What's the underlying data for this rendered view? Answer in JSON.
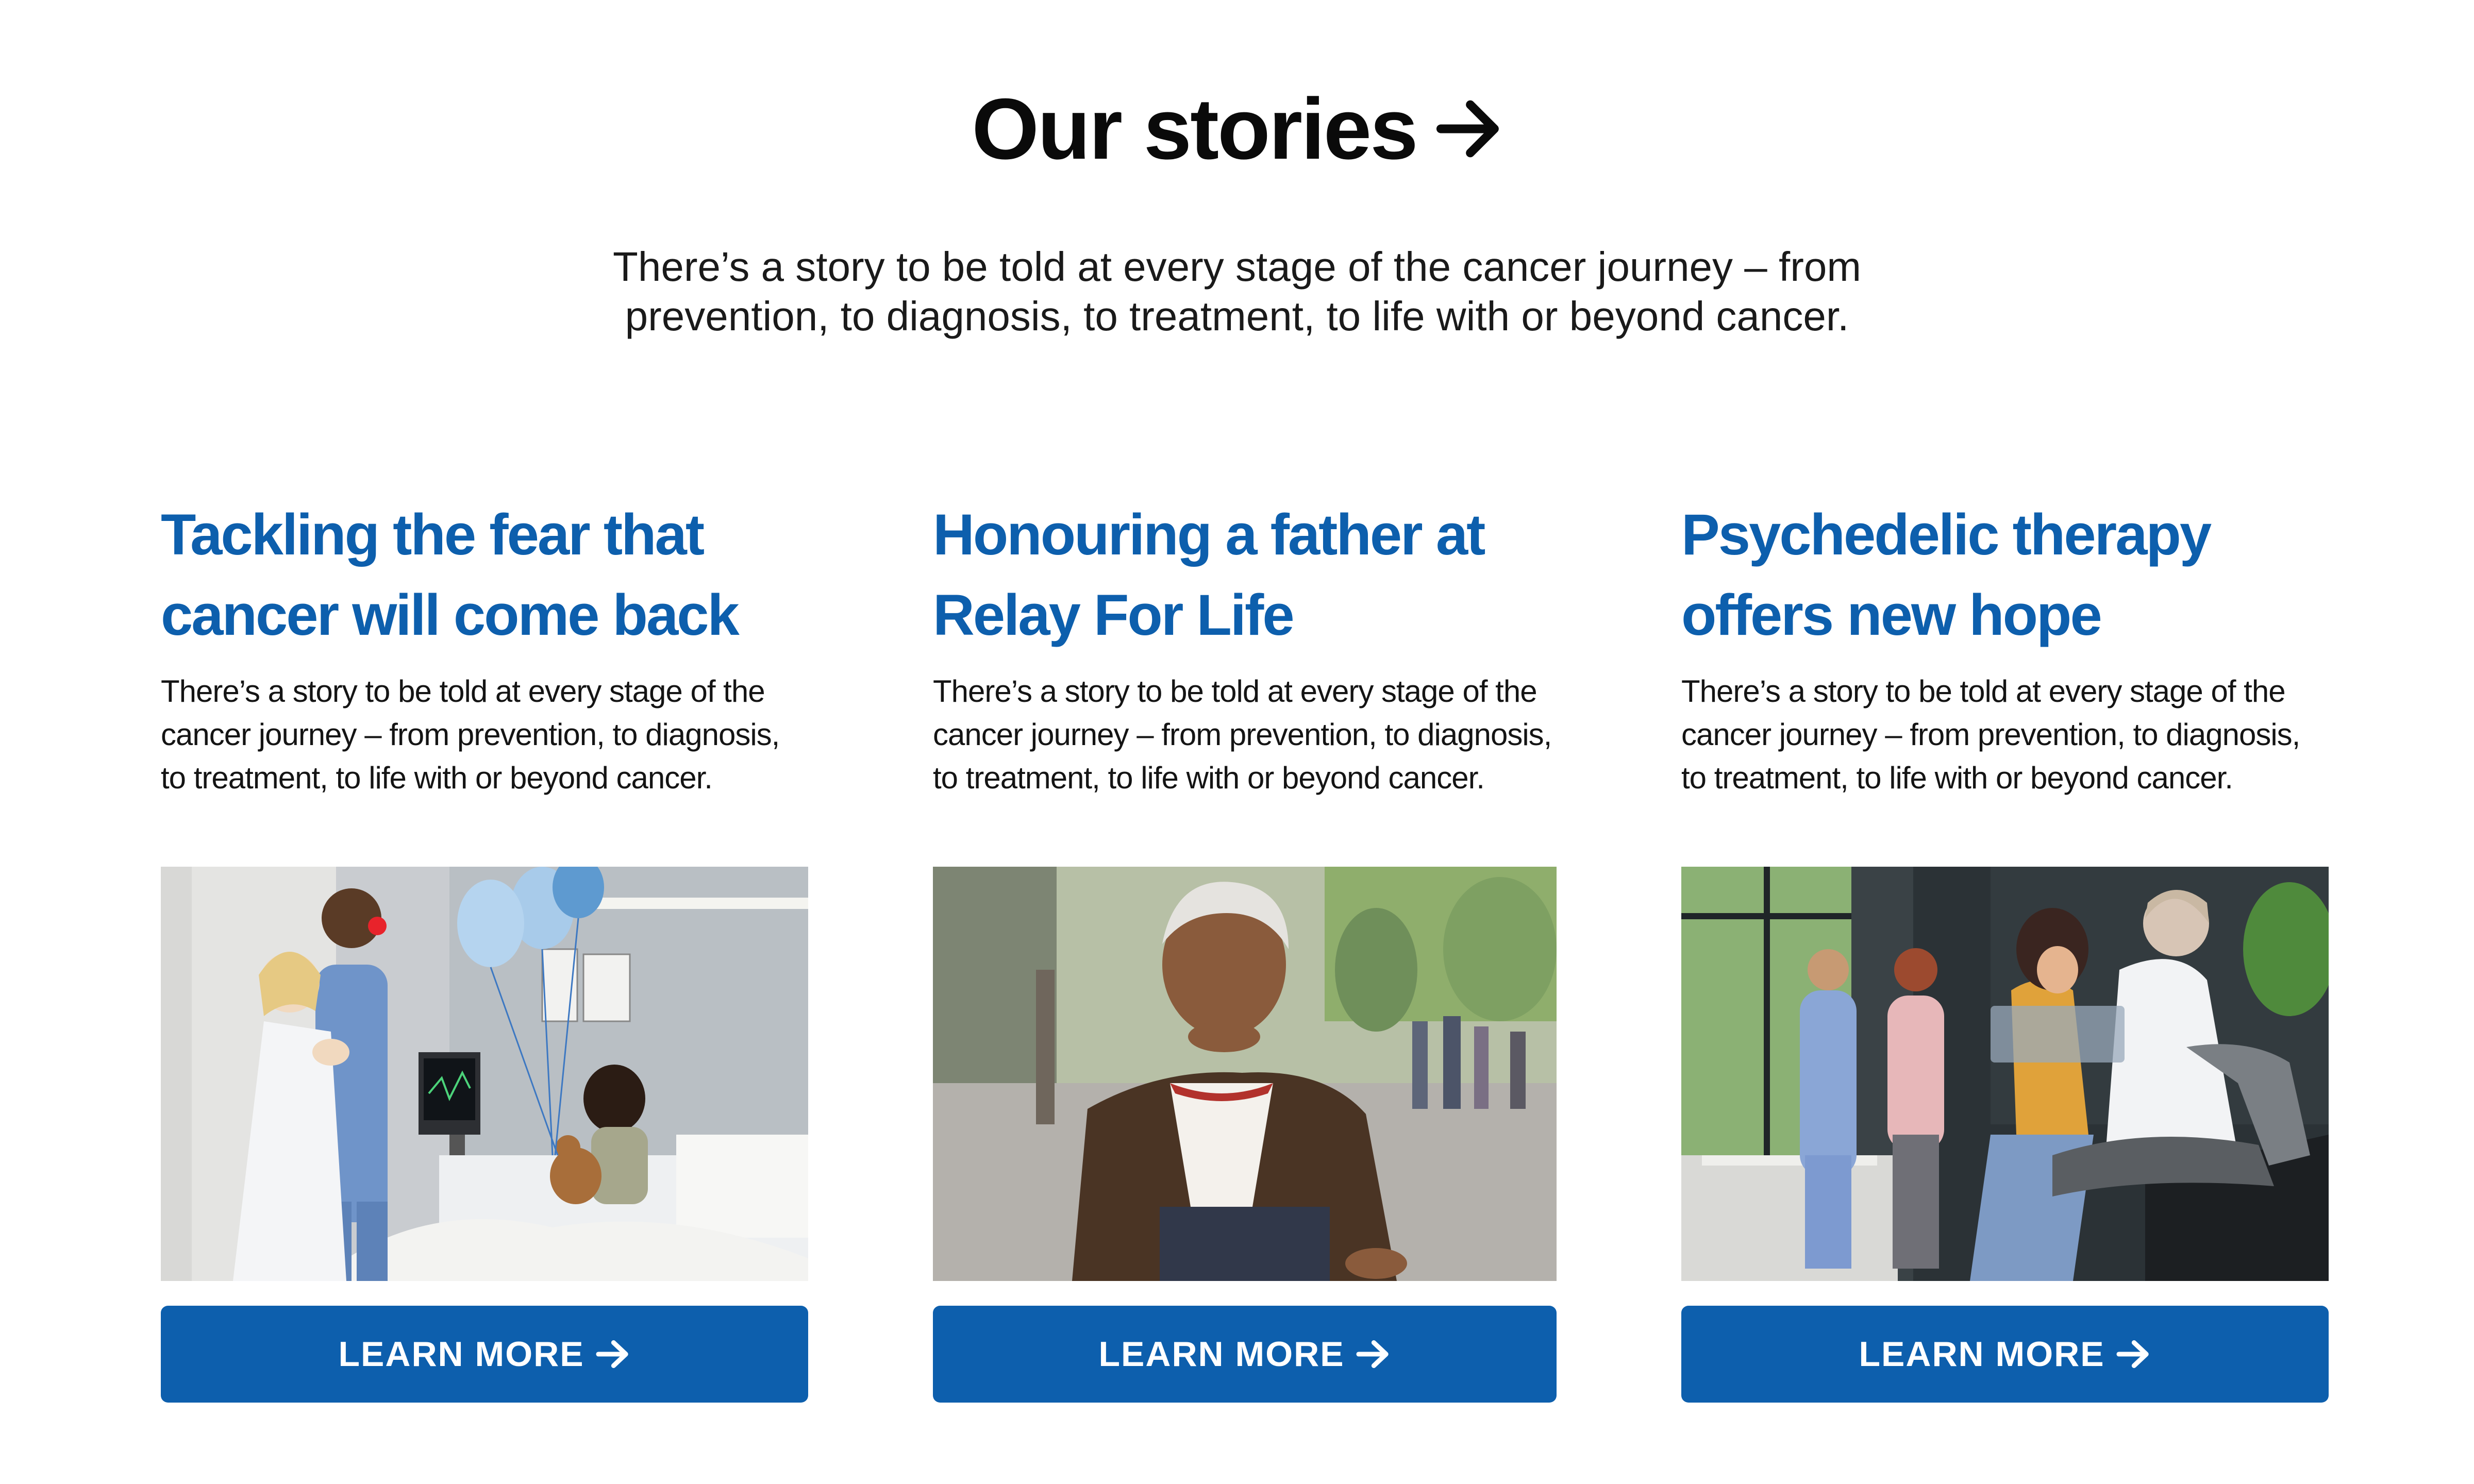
{
  "section": {
    "title": "Our stories",
    "title_icon": "arrow-right-icon",
    "intro": "There’s a story to be told at every stage of the cancer journey – from prevention, to diagnosis, to treatment, to life with or beyond cancer."
  },
  "colors": {
    "brand_blue": "#0d5fad",
    "heading": "#0a0a0a",
    "button_text": "#ffffff"
  },
  "cards": [
    {
      "title": "Tackling the fear that\ncancer will come back",
      "body": "There’s a story to be told at every stage of the cancer journey – from prevention, to diagnosis, to treatment, to life with or beyond cancer.",
      "image_alt": "Doctors with a clown nose entertaining a child patient holding a teddy bear and blue balloons in a hospital bed",
      "button_label": "LEARN MORE",
      "button_icon": "arrow-right-icon"
    },
    {
      "title": "Honouring a father  at\nRelay For Life",
      "body": "There’s a story to be told at every stage of the cancer journey – from prevention, to diagnosis, to treatment, to life with or beyond cancer.",
      "image_alt": "Elderly man in a brown cardigan smiling on a city street",
      "button_label": "LEARN MORE",
      "button_icon": "arrow-right-icon"
    },
    {
      "title": "Psychedelic therapy\noffers new hope",
      "body": "There’s a story to be told at every stage of the cancer journey – from prevention, to diagnosis, to treatment, to life with or beyond cancer.",
      "image_alt": "Doctor showing an x-ray to a patient in a clinic waiting area with medical staff in the background",
      "button_label": "LEARN MORE",
      "button_icon": "arrow-right-icon"
    }
  ]
}
